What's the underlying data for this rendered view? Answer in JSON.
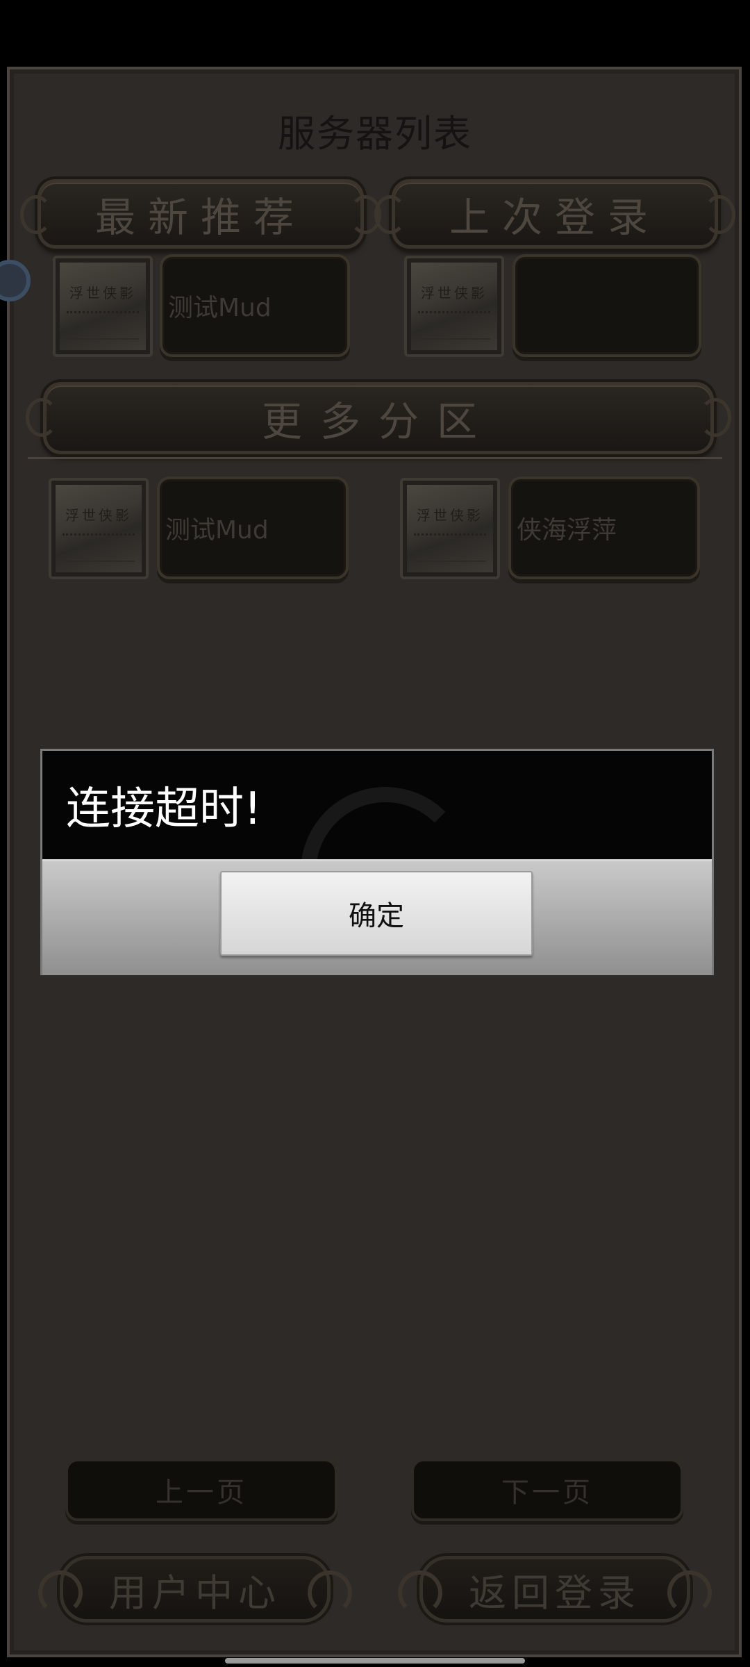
{
  "header": {
    "title": "服务器列表"
  },
  "tabs": {
    "recommended": "最新推荐",
    "last_login": "上次登录",
    "more": "更多分区"
  },
  "recommended_server": {
    "thumb_text": "浮世侠影",
    "name": "测试Mud"
  },
  "last_login_server": {
    "thumb_text": "浮世侠影",
    "name": ""
  },
  "more_servers": [
    {
      "thumb_text": "浮世侠影",
      "name": "测试Mud"
    },
    {
      "thumb_text": "浮世侠影",
      "name": "侠海浮萍"
    }
  ],
  "pagination": {
    "prev": "上一页",
    "next": "下一页"
  },
  "bottom": {
    "user_center": "用户中心",
    "back_login": "返回登录"
  },
  "dialog": {
    "message": "连接超时!",
    "ok": "确定"
  }
}
